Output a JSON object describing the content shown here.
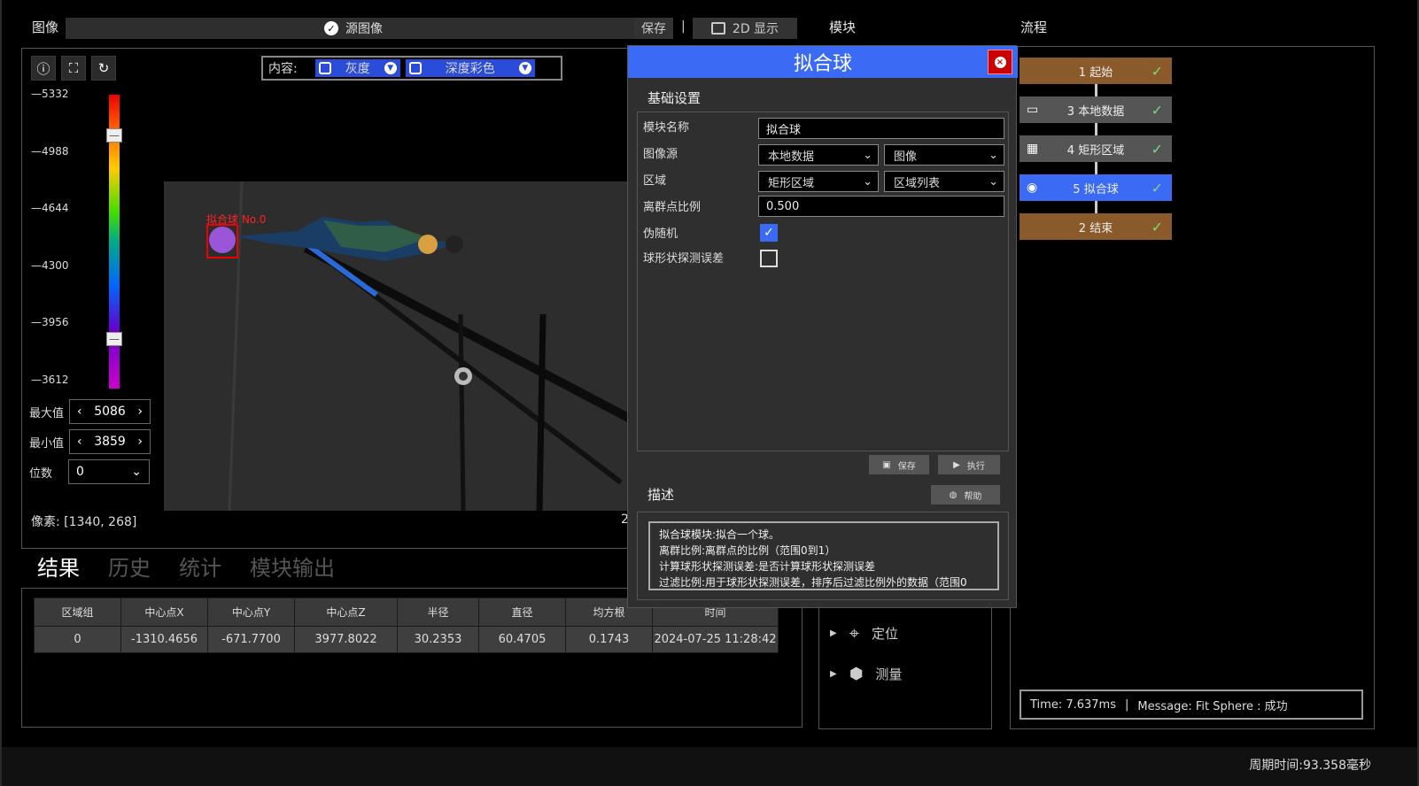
{
  "header": {
    "image_label": "图像",
    "source_label": "源图像",
    "save_label": "保存",
    "separator": "|",
    "display_label": "2D 显示",
    "module_label": "模块",
    "flow_label": "流程"
  },
  "viewer": {
    "content_label": "内容:",
    "gray_label": "灰度",
    "depth_label": "深度彩色",
    "scale": [
      "5332",
      "4988",
      "4644",
      "4300",
      "3956",
      "3612"
    ],
    "max_label": "最大值",
    "max_value": "5086",
    "min_label": "最小值",
    "min_value": "3859",
    "digits_label": "位数",
    "digits_value": "0",
    "pixel_text": "像素: [1340, 268]",
    "overlay_label": "拟合球 No.0",
    "edge_text": "2"
  },
  "tabs": [
    "结果",
    "历史",
    "统计",
    "模块输出"
  ],
  "results": {
    "headers": [
      "区域组",
      "中心点X",
      "中心点Y",
      "中心点Z",
      "半径",
      "直径",
      "均方根",
      "时间"
    ],
    "rows": [
      [
        "0",
        "-1310.4656",
        "-671.7700",
        "3977.8022",
        "30.2353",
        "60.4705",
        "0.1743",
        "2024-07-25 11:28:42"
      ]
    ]
  },
  "modules": [
    {
      "label": "定位",
      "icon": "crosshair-icon"
    },
    {
      "label": "测量",
      "icon": "cube-icon"
    }
  ],
  "flow": {
    "nodes": [
      {
        "label": "1 起始",
        "color": "#8a5a2b",
        "icon": ""
      },
      {
        "label": "3 本地数据",
        "color": "#555555",
        "icon": "folder-icon"
      },
      {
        "label": "4 矩形区域",
        "color": "#555555",
        "icon": "grid-icon"
      },
      {
        "label": "5 拟合球",
        "color": "#3b6af5",
        "icon": "sphere-icon"
      },
      {
        "label": "2 结束",
        "color": "#8a5a2b",
        "icon": ""
      }
    ],
    "status": {
      "time": "Time: 7.637ms",
      "sep": "|",
      "message": "Message: Fit Sphere : 成功"
    }
  },
  "dialog": {
    "title": "拟合球",
    "basic_title": "基础设置",
    "fields": {
      "name_label": "模块名称",
      "name_value": "拟合球",
      "source_label": "图像源",
      "source_value": "本地数据",
      "source_sub": "图像",
      "region_label": "区域",
      "region_value": "矩形区域",
      "region_sub": "区域列表",
      "outlier_label": "离群点比例",
      "outlier_value": "0.500",
      "pseudo_label": "伪随机",
      "pseudo_checked": true,
      "shape_label": "球形状探测误差",
      "shape_checked": false
    },
    "save_label": "保存",
    "run_label": "执行",
    "desc_title": "描述",
    "help_label": "帮助",
    "desc_lines": [
      "拟合球模块:拟合一个球。",
      "离群比例:离群点的比例（范围0到1）",
      "计算球形状探测误差:是否计算球形状探测误差",
      "过滤比例:用于球形状探测误差，排序后过滤比例外的数据（范围0"
    ]
  },
  "footer": {
    "cycle_time": "周期时间:93.358毫秒"
  }
}
